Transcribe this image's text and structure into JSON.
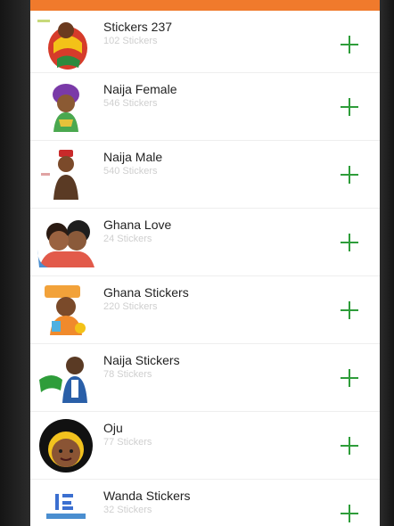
{
  "colors": {
    "appbar": "#f07a2c",
    "add_icon": "#2e9d3a",
    "title": "#222222",
    "count": "#cfcfcf"
  },
  "packs": [
    {
      "title": "Stickers 237",
      "count": "102 Stickers",
      "icon": "plus-icon"
    },
    {
      "title": "Naija Female",
      "count": "546 Stickers",
      "icon": "plus-icon"
    },
    {
      "title": "Naija Male",
      "count": "540 Stickers",
      "icon": "plus-icon"
    },
    {
      "title": "Ghana Love",
      "count": "24 Stickers",
      "icon": "plus-icon"
    },
    {
      "title": "Ghana Stickers",
      "count": "220 Stickers",
      "icon": "plus-icon"
    },
    {
      "title": "Naija Stickers",
      "count": "78 Stickers",
      "icon": "plus-icon"
    },
    {
      "title": "Oju",
      "count": "77 Stickers",
      "icon": "plus-icon"
    },
    {
      "title": "Wanda Stickers",
      "count": "32 Stickers",
      "icon": "plus-icon"
    }
  ]
}
